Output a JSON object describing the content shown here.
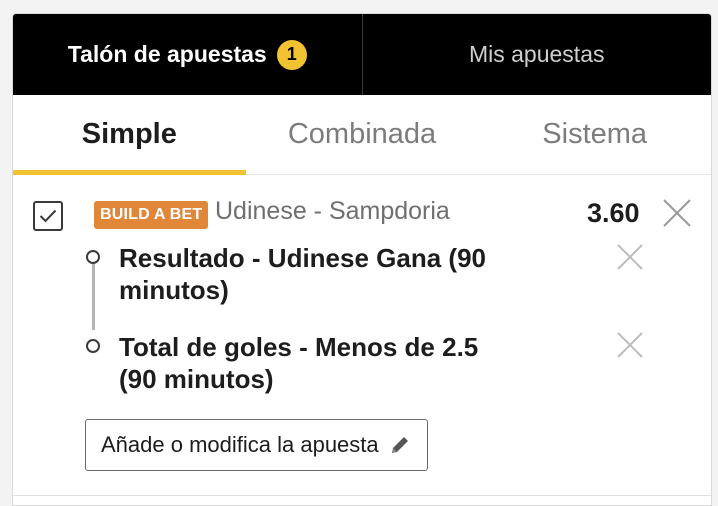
{
  "top_tabs": {
    "betslip_label": "Talón de apuestas",
    "betslip_count": "1",
    "mybets_label": "Mis apuestas"
  },
  "sub_tabs": {
    "simple": "Simple",
    "combined": "Combinada",
    "system": "Sistema",
    "active": "Simple"
  },
  "bet": {
    "checked": true,
    "tag": "BUILD A BET",
    "match": "Udinese - Sampdoria",
    "odds": "3.60",
    "selections": [
      {
        "label": "Resultado - Udinese Gana (90 minutos)"
      },
      {
        "label": "Total de goles - Menos de 2.5 (90 minutos)"
      }
    ],
    "edit_button": "Añade o modifica la apuesta"
  },
  "colors": {
    "accent_yellow": "#f1c330",
    "tag_orange": "#e1873a",
    "topbar_black": "#000000"
  },
  "icons": [
    "checkbox-checked-icon",
    "close-icon",
    "pencil-icon"
  ]
}
